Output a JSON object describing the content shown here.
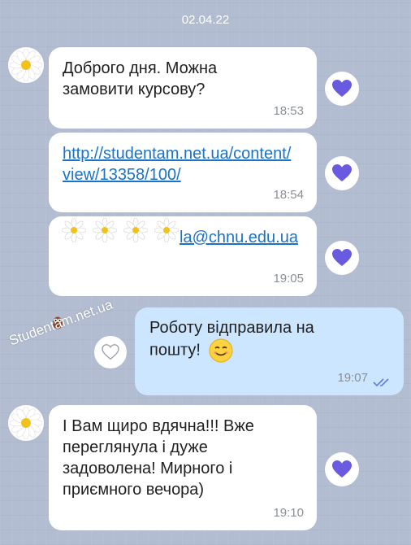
{
  "chat": {
    "date": "02.04.22",
    "messages": [
      {
        "text": "Доброго дня. Можна замовити курсову?",
        "time": "18:53"
      },
      {
        "text": "http://studentam.net.ua/content/view/13358/100/",
        "time": "18:54"
      },
      {
        "text": "la@chnu.edu.ua",
        "time": "19:05"
      },
      {
        "text": "Роботу відправила на пошту!",
        "time": "19:07"
      },
      {
        "text": "І Вам щиро вдячна!!! Вже переглянула і дуже задоволена! Мирного і приємного вечора)",
        "time": "19:10"
      }
    ]
  },
  "watermark": "Studentam.net.ua",
  "emoji": "smiling-face",
  "colors": {
    "background": "#b3bdd2",
    "incoming_bubble": "#ffffff",
    "outgoing_bubble": "#cde6ff",
    "link": "#1a73c9",
    "heart": "#6a5ae0",
    "read_ticks": "#5b7fd8"
  },
  "icons": {
    "avatar": "daisy-avatar",
    "reaction": "heart-icon",
    "reaction_empty": "heart-outline-icon",
    "status": "double-check-icon"
  }
}
